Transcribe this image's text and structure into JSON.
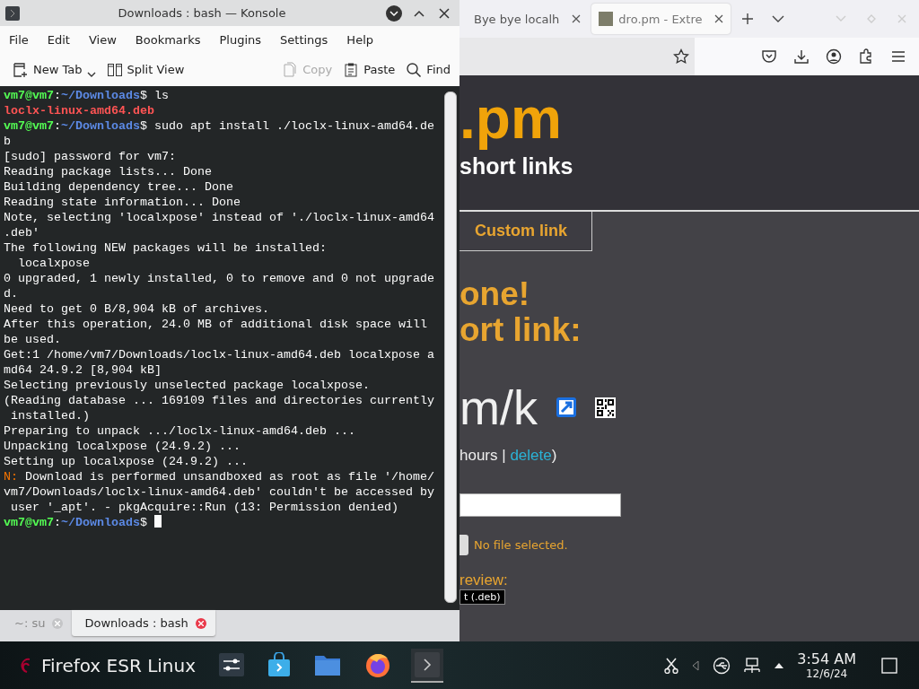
{
  "konsole": {
    "title": "Downloads : bash — Konsole",
    "menu": [
      "File",
      "Edit",
      "View",
      "Bookmarks",
      "Plugins",
      "Settings",
      "Help"
    ],
    "toolbar": [
      {
        "kind": "newtab",
        "label": "New Tab",
        "disabled": false,
        "dropdown": true
      },
      {
        "kind": "split",
        "label": "Split View",
        "disabled": false,
        "dropdown": false
      },
      {
        "kind": "copy",
        "label": "Copy",
        "disabled": true,
        "dropdown": false
      },
      {
        "kind": "paste",
        "label": "Paste",
        "disabled": false,
        "dropdown": false
      },
      {
        "kind": "find",
        "label": "Find",
        "disabled": false,
        "dropdown": false
      }
    ],
    "terminal": {
      "lines": [
        {
          "kind": "prompt",
          "user": "vm7@vm7",
          "sep": ":",
          "path": "~/Downloads",
          "sign": "$",
          "command": " ls",
          "cursor": false
        },
        {
          "kind": "file",
          "text": "loclx-linux-amd64.deb"
        },
        {
          "kind": "prompt",
          "user": "vm7@vm7",
          "sep": ":",
          "path": "~/Downloads",
          "sign": "$",
          "command": " sudo apt install ./loclx-linux-amd64.de",
          "cursor": false
        },
        {
          "kind": "output",
          "text": "b"
        },
        {
          "kind": "output",
          "text": "[sudo] password for vm7:"
        },
        {
          "kind": "output",
          "text": "Reading package lists... Done"
        },
        {
          "kind": "output",
          "text": "Building dependency tree... Done"
        },
        {
          "kind": "output",
          "text": "Reading state information... Done"
        },
        {
          "kind": "output",
          "text": "Note, selecting 'localxpose' instead of './loclx-linux-amd64"
        },
        {
          "kind": "output",
          "text": ".deb'"
        },
        {
          "kind": "output",
          "text": "The following NEW packages will be installed:"
        },
        {
          "kind": "output",
          "text": "  localxpose"
        },
        {
          "kind": "output",
          "text": "0 upgraded, 1 newly installed, 0 to remove and 0 not upgrade"
        },
        {
          "kind": "output",
          "text": "d."
        },
        {
          "kind": "output",
          "text": "Need to get 0 B/8,904 kB of archives."
        },
        {
          "kind": "output",
          "text": "After this operation, 24.0 MB of additional disk space will"
        },
        {
          "kind": "output",
          "text": "be used."
        },
        {
          "kind": "output",
          "text": "Get:1 /home/vm7/Downloads/loclx-linux-amd64.deb localxpose a"
        },
        {
          "kind": "output",
          "text": "md64 24.9.2 [8,904 kB]"
        },
        {
          "kind": "output",
          "text": "Selecting previously unselected package localxpose."
        },
        {
          "kind": "output",
          "text": "(Reading database ... 169109 files and directories currently"
        },
        {
          "kind": "output",
          "text": " installed.)"
        },
        {
          "kind": "output",
          "text": "Preparing to unpack .../loclx-linux-amd64.deb ..."
        },
        {
          "kind": "output",
          "text": "Unpacking localxpose (24.9.2) ..."
        },
        {
          "kind": "output",
          "text": "Setting up localxpose (24.9.2) ..."
        },
        {
          "kind": "notice",
          "tag": "N:",
          "text": " Download is performed unsandboxed as root as file '/home/"
        },
        {
          "kind": "output",
          "text": "vm7/Downloads/loclx-linux-amd64.deb' couldn't be accessed by"
        },
        {
          "kind": "output",
          "text": " user '_apt'. - pkgAcquire::Run (13: Permission denied)"
        },
        {
          "kind": "prompt",
          "user": "vm7@vm7",
          "sep": ":",
          "path": "~/Downloads",
          "sign": "$",
          "cursor": true
        }
      ]
    },
    "tabs": [
      {
        "label": "~: su",
        "selected": false
      },
      {
        "label": "Downloads : bash",
        "selected": true
      }
    ]
  },
  "browser": {
    "tabs": [
      {
        "label": "Bye bye localh",
        "selected": false
      },
      {
        "label": "dro.pm - Extre",
        "selected": true
      }
    ],
    "page": {
      "logo": ".pm",
      "tagline": "short links",
      "tab": "Custom link",
      "heading_lines": [
        "one!",
        "ort link:"
      ],
      "short_link": "m/k",
      "expiry": "hours | ",
      "delete_link": "delete",
      "expiry_end": ")",
      "file_status": "No file selected.",
      "preview_label": "review:",
      "preview_badge": "t (.deb)"
    }
  },
  "taskbar": {
    "window_title": "Firefox ESR Linux",
    "apps": [
      {
        "kind": "settings",
        "active": false
      },
      {
        "kind": "store",
        "active": false
      },
      {
        "kind": "files",
        "active": false
      },
      {
        "kind": "firefox",
        "active": false
      },
      {
        "kind": "terminal",
        "active": true
      }
    ],
    "clock": {
      "time": "3:54 AM",
      "date": "12/6/24"
    }
  }
}
